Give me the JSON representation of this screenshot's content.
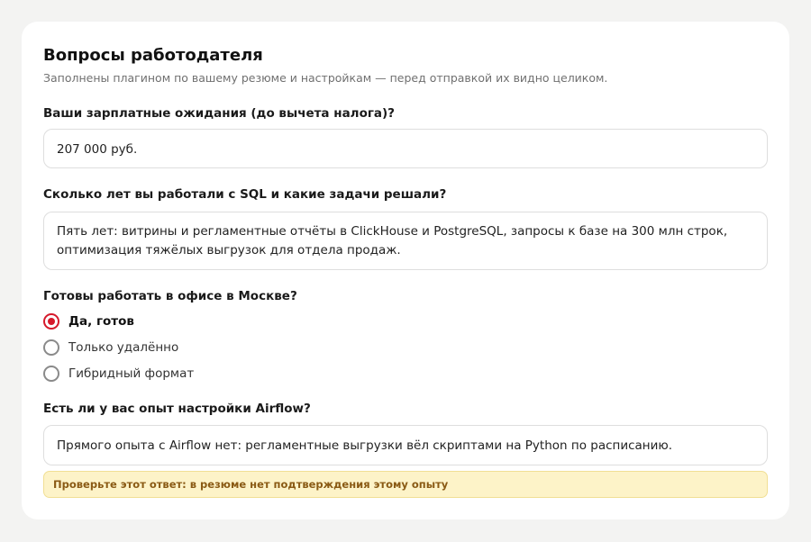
{
  "header": {
    "title": "Вопросы работодателя",
    "subtitle": "Заполнены плагином по вашему резюме и настройкам — перед отправкой их видно целиком."
  },
  "questions": [
    {
      "label": "Ваши зарплатные ожидания (до вычета налога)?",
      "answer": "207 000 руб."
    },
    {
      "label": "Сколько лет вы работали с SQL и какие задачи решали?",
      "answer": "Пять лет: витрины и регламентные отчёты в ClickHouse и PostgreSQL, запросы к базе на 300 млн строк, оптимизация тяжёлых выгрузок для отдела продаж."
    },
    {
      "label": "Готовы работать в офисе в Москве?",
      "options": [
        "Да, готов",
        "Только удалённо",
        "Гибридный формат"
      ],
      "selected": "Да, готов"
    },
    {
      "label": "Есть ли у вас опыт настройки Airflow?",
      "answer": "Прямого опыта с Airflow нет: регламентные выгрузки вёл скриптами на Python по расписанию.",
      "warning": "Проверьте этот ответ: в резюме нет подтверждения этому опыту"
    }
  ],
  "colors": {
    "accent": "#d6192b",
    "warning_bg": "#fdf3c8",
    "warning_text": "#8a5a14"
  }
}
